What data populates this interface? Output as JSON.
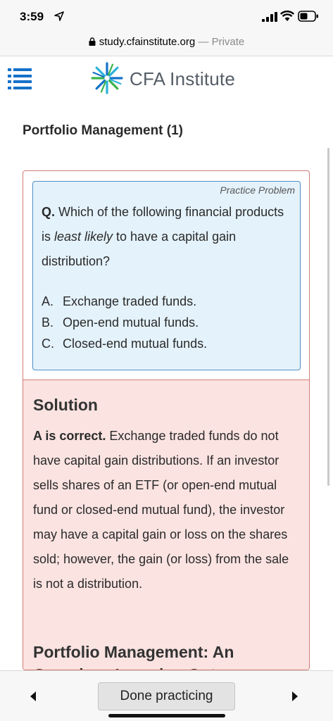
{
  "status_bar": {
    "time": "3:59"
  },
  "url_bar": {
    "domain": "study.cfainstitute.org",
    "separator": "—",
    "mode": "Private"
  },
  "header": {
    "logo_text": "CFA Institute",
    "brand_color": "#1571c9"
  },
  "page": {
    "title": "Portfolio Management (1)"
  },
  "question": {
    "label": "Practice Problem",
    "prefix": "Q.",
    "text_before": " Which of the following financial products is ",
    "emphasis": "least likely",
    "text_after": " to have a capital gain distribution?",
    "options": [
      {
        "letter": "A.",
        "text": "Exchange traded funds."
      },
      {
        "letter": "B.",
        "text": "Open-end mutual funds."
      },
      {
        "letter": "C.",
        "text": "Closed-end mutual funds."
      }
    ]
  },
  "solution": {
    "heading": "Solution",
    "correct": "A is correct.",
    "body": " Exchange traded funds do not have capital gain distributions. If an investor sells shares of an ETF (or open-end mutual fund or closed-end mutual fund), the investor may have a capital gain or loss on the shares sold; however, the gain (or loss) from the sale is not a distribution.",
    "next_heading": "Portfolio Management: An Overview: Learning Outcomes"
  },
  "footer": {
    "done_label": "Done practicing"
  }
}
